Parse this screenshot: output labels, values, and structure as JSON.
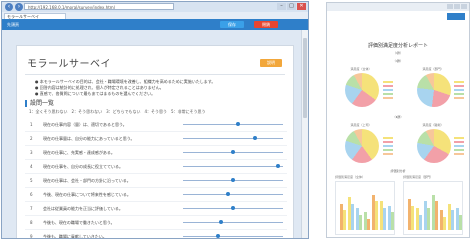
{
  "browser": {
    "address": "http://192.168.0.1/moral/survey/index.html",
    "tab_label": "モラールサーベイ",
    "controls": [
      "–",
      "□",
      "✕"
    ]
  },
  "appbar": {
    "title": "先頭頁",
    "save_label": "保存",
    "close_label": "閉鎖"
  },
  "survey": {
    "title": "モラールサーベイ",
    "help_label": "説明",
    "notes": [
      "● 本モラールサーベイの目的は、会社・職場環境を改善し、組織力を高めるために実施いたします。",
      "● 回答内容は統計的に処理され、個人が特定されることはありません。",
      "● 直感で、各質問について最もあてはまるものを選んでください。"
    ],
    "section_heading": "設問一覧",
    "scale_text": "1：全くそう思わない　2：そう思わない　3：どちらでもない　4：そう思う　5：非常にそう思う",
    "questions": [
      {
        "num": "1",
        "text": "現在の仕事内容（量）は、適切であると思う。",
        "value": 0.55
      },
      {
        "num": "2",
        "text": "現在の仕事量は、自分の能力にあっていると思う。",
        "value": 0.72
      },
      {
        "num": "3",
        "text": "現在の仕事に、充実感・達成感がある。",
        "value": 0.5
      },
      {
        "num": "4",
        "text": "現在の仕事を、自分の成長に役立てている。",
        "value": 0.95
      },
      {
        "num": "5",
        "text": "現在の仕事は、会社・部門の方針に沿っている。",
        "value": 0.5
      },
      {
        "num": "6",
        "text": "今後、現在の仕事について将来性を感じている。",
        "value": 0.45
      },
      {
        "num": "7",
        "text": "会社は従業員の能力を正当に評価している。",
        "value": 0.5
      },
      {
        "num": "8",
        "text": "今後も、現在の職場で働きたいと思う。",
        "value": 0.38
      },
      {
        "num": "9",
        "text": "今後も、職場に貢献していきたい。",
        "value": 0.35
      }
    ]
  },
  "report": {
    "title": "評価別満足度分析レポート",
    "subtitle": "（Ⅰ群）",
    "section1": "〈Ⅰ群〉",
    "section2": "〈Ⅱ群〉",
    "section3": "評価別分析",
    "pie_captions": [
      "満足度（全体）",
      "満足度（部門）",
      "満足度（上司）",
      "満足度（職場）"
    ],
    "bar_captions": [
      "評価別満足度（全体）",
      "評価別満足度（部門）"
    ],
    "pie_colors": [
      "#f5e27a",
      "#f2a0a8",
      "#a8d4ef",
      "#b9e0a8",
      "#f7c79a"
    ],
    "bar_colors": [
      "#f2b36e",
      "#f5e27a",
      "#a8d4ef",
      "#b9e0a8"
    ],
    "accent": "#2f7fc9"
  }
}
